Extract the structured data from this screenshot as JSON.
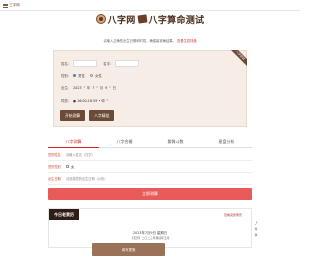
{
  "topbar": {
    "menu_label": "三字网"
  },
  "logo": {
    "brand": "八字网",
    "title": "八字算命测试"
  },
  "notice": {
    "text": "请输入正确的出生日期和时辰，确保最准确结果。",
    "link": "查看生辰排盘"
  },
  "form": {
    "ribbon": "八字测试",
    "surname_label": "姓名：",
    "name_label": "名字：",
    "gender_label": "性别：",
    "gender_male": "男性",
    "gender_female": "女性",
    "birth_label": "出生：",
    "year": "2023",
    "year_unit": "年",
    "month": "7",
    "month_unit": "月",
    "day": "9",
    "day_unit": "日",
    "time_label": "时辰：",
    "time_value": "● 16:00-18:59 • 申",
    "submit_label": "开始测算",
    "bazi_label": "八字精批"
  },
  "tabs": [
    "八字测算",
    "八字合婚",
    "紫微斗数",
    "星盘分析"
  ],
  "bazi_form": {
    "name_label": "您的姓名",
    "name_placeholder": "请输入姓名（汉字）",
    "gender_label": "您的性别",
    "gender_value": "女",
    "birth_label": "出生日期",
    "birth_placeholder": "请选择您的出生日期（公历）"
  },
  "submit_button": "立即测算",
  "today": {
    "title": "今日老黄历",
    "link": "查看完整黄历",
    "date": "2023年7月9日 星期日",
    "term": "【农历】二〇二三年癸卯年五月",
    "side_icons": [
      "分",
      "享"
    ]
  },
  "fab": "填写提测"
}
